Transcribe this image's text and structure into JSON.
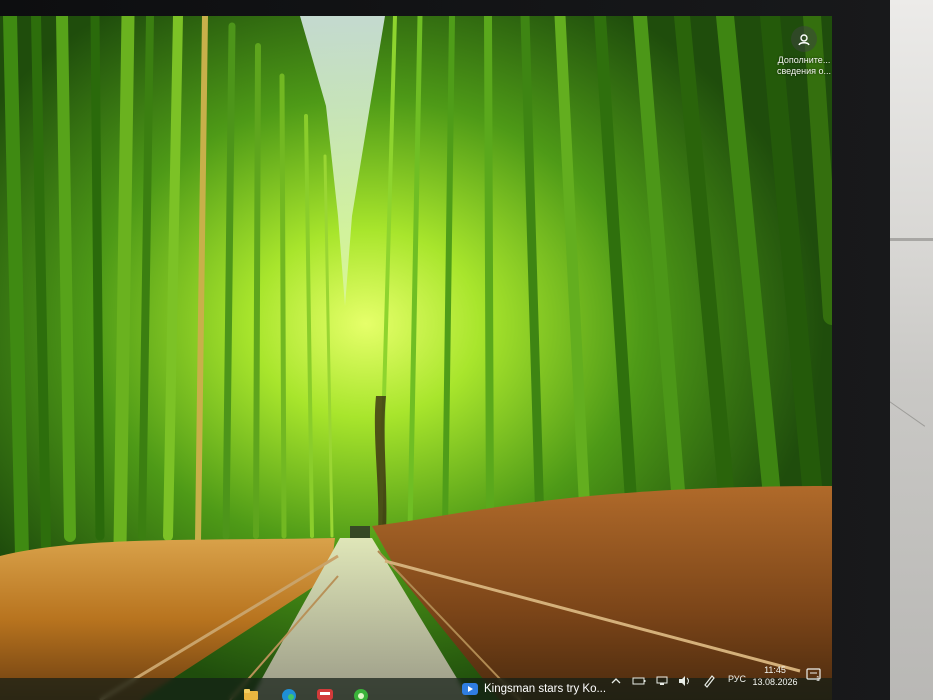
{
  "desktop": {
    "spotlight": {
      "icon": "camera-icon",
      "line1": "Дополните...",
      "line2": "сведения о..."
    }
  },
  "taskbar": {
    "media": {
      "icon": "play-icon",
      "title": "Kingsman stars try Ko..."
    },
    "tray": {
      "language": "РУС",
      "time": "11:45",
      "date": "13.08.2026",
      "notification_count": "1"
    },
    "pinned": [
      "explorer-icon",
      "edge-icon",
      "app-badge-icon",
      "green-app-icon"
    ]
  },
  "colors": {
    "accent": "#2f7de1",
    "bamboo_light": "#a6e82a",
    "bamboo_dark": "#1d4a0e",
    "grass": "#c98b2e"
  }
}
